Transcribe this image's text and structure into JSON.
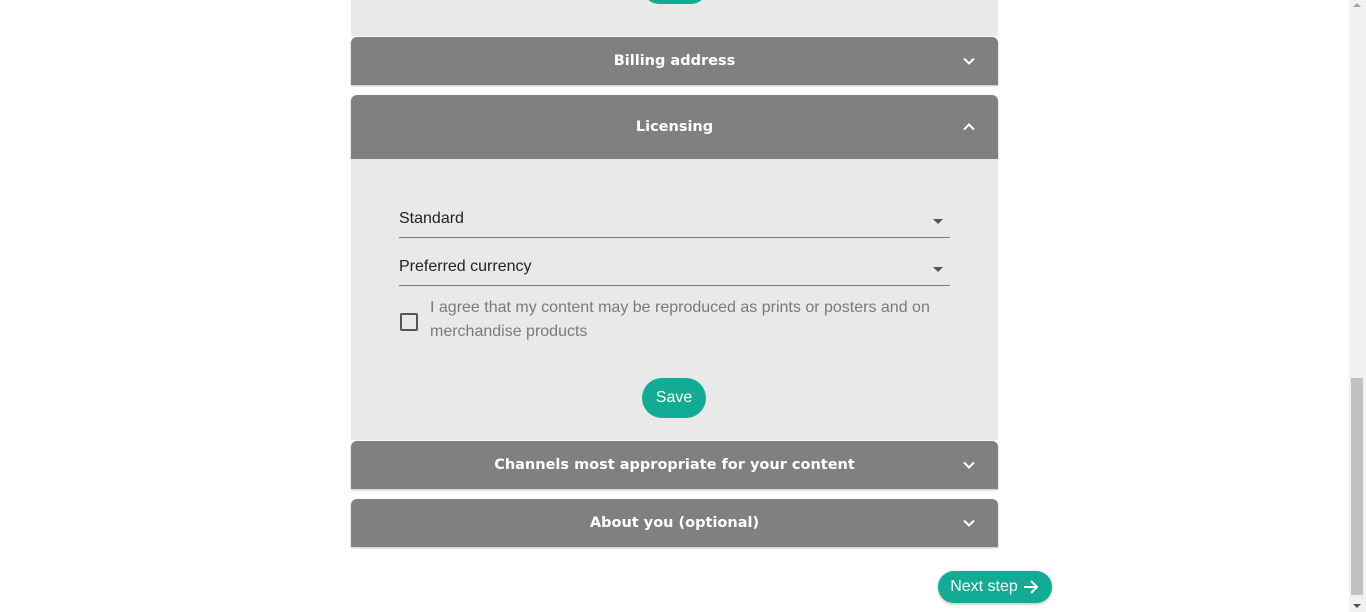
{
  "colors": {
    "accent": "#12ab94",
    "accordion_header": "#808080",
    "panel_background": "#e9e9e9"
  },
  "accordion": {
    "billing": {
      "title": "Billing address",
      "icon": "chevron-down-icon"
    },
    "licensing": {
      "title": "Licensing",
      "icon": "chevron-up-icon",
      "license_select": {
        "value": "Standard"
      },
      "currency_select": {
        "value": "Preferred currency"
      },
      "agree_checkbox": {
        "checked": false,
        "label": "I agree that my content may be reproduced as prints or posters and on merchandise products"
      },
      "save_label": "Save"
    },
    "channels": {
      "title": "Channels most appropriate for your content",
      "icon": "chevron-down-icon"
    },
    "about": {
      "title": "About you (optional)",
      "icon": "chevron-down-icon"
    }
  },
  "next_step": {
    "label": "Next step",
    "icon": "arrow-right-icon"
  }
}
